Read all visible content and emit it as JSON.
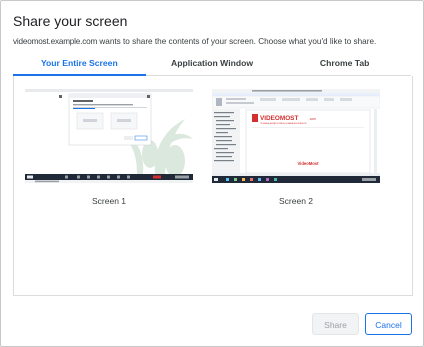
{
  "dialog": {
    "title": "Share your screen",
    "subtitle_domain": "videomost.example.com",
    "subtitle_rest": " wants to share the contents of your screen. Choose what you'd like to share."
  },
  "tabs": [
    {
      "label": "Your Entire Screen",
      "active": true
    },
    {
      "label": "Application Window",
      "active": false
    },
    {
      "label": "Chrome Tab",
      "active": false
    }
  ],
  "screens": [
    {
      "label": "Screen 1",
      "selected": false
    },
    {
      "label": "Screen 2",
      "selected": false
    }
  ],
  "screen2_preview": {
    "brand_text": "VIDEOMOST",
    "brand_suffix": ".com",
    "brand_tagline": "ЛУЧШАЯ ВИДЕОСВЯЗЬ В ВАШЕМ БИЗНЕСЕ",
    "footer_logo": "VideoMost"
  },
  "buttons": {
    "share": "Share",
    "cancel": "Cancel"
  },
  "colors": {
    "accent": "#1a73e8",
    "brand_red": "#d32f2f",
    "taskbar": "#1f2937"
  }
}
